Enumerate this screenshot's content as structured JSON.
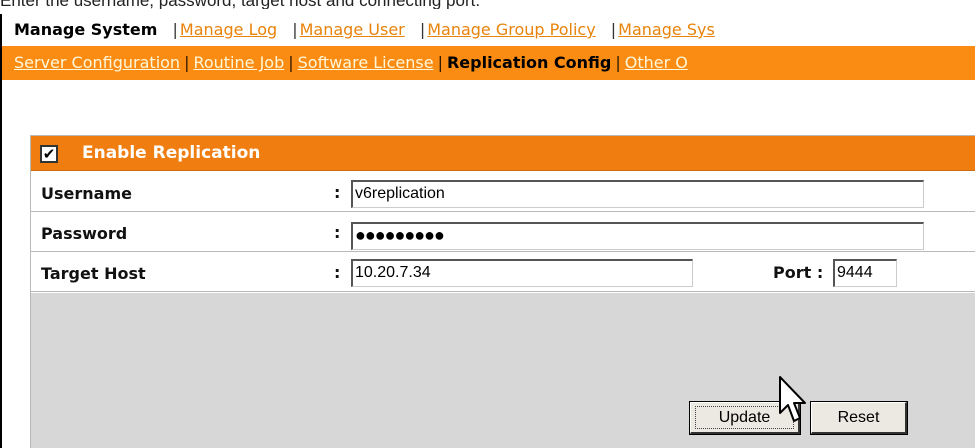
{
  "caption": "Enter the username, password, target host and connecting port.",
  "nav_primary": {
    "current": "Manage System",
    "links": [
      "Manage Log",
      "Manage User",
      "Manage Group Policy",
      "Manage Sys"
    ]
  },
  "nav_secondary": {
    "links_before": [
      "Server Configuration",
      "Routine Job",
      "Software License"
    ],
    "current": "Replication Config",
    "links_after": [
      "Other O"
    ]
  },
  "panel": {
    "title": "Enable Replication",
    "checkbox_checked": true,
    "checkbox_glyph": "✔"
  },
  "form": {
    "username_label": "Username",
    "username_value": "v6replication",
    "password_label": "Password",
    "password_value": "●●●●●●●●●",
    "target_host_label": "Target Host",
    "target_host_value": "10.20.7.34",
    "port_label": "Port :",
    "port_value": "9444",
    "colon": ":"
  },
  "buttons": {
    "update": "Update",
    "reset": "Reset"
  },
  "colors": {
    "orange_bar": "#fa8c14",
    "panel_header": "#f07d10",
    "link_orange": "#e8830c",
    "gray_area": "#d7d7d7"
  },
  "icons": {
    "cursor": "pointer-arrow-cursor",
    "checkbox": "checkmark-icon"
  }
}
